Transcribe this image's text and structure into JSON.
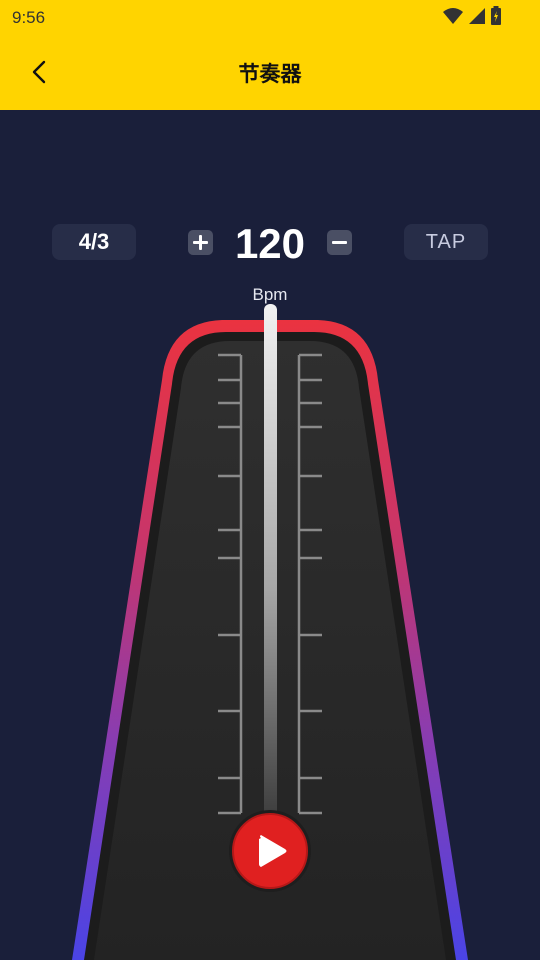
{
  "status_bar": {
    "time": "9:56"
  },
  "header": {
    "title": "节奏器"
  },
  "controls": {
    "time_signature": "4/3",
    "bpm": "120",
    "bpm_unit": "Bpm",
    "tap_label": "TAP"
  },
  "colors": {
    "header_bg": "#ffd400",
    "page_bg": "#1a1f3a",
    "play_red": "#e02020",
    "frame_top": "#ea3340",
    "frame_bottom": "#5540e0"
  },
  "icons": [
    "wifi-icon",
    "signal-icon",
    "battery-icon",
    "back-arrow-icon",
    "plus-icon",
    "minus-icon",
    "play-icon"
  ]
}
